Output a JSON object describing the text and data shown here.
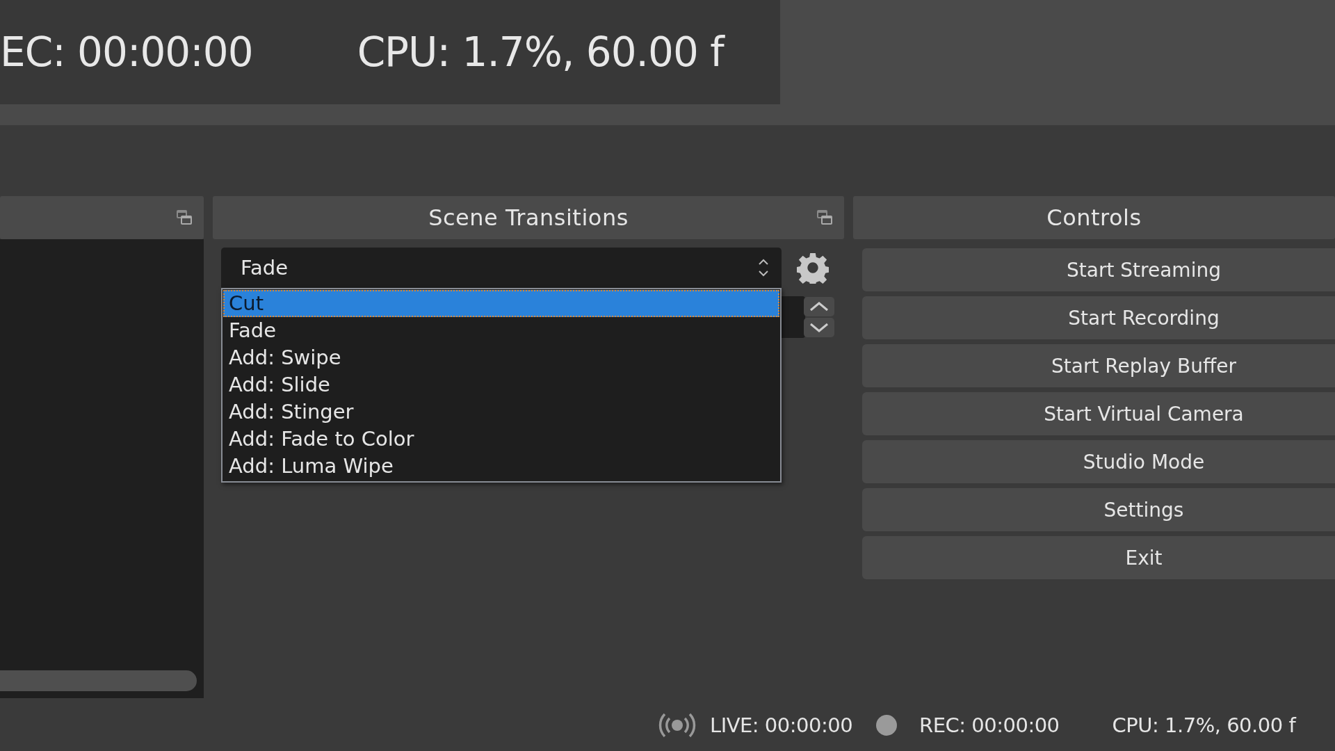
{
  "stats_overlay": {
    "recording_time": "EC: 00:00:00",
    "cpu": "CPU: 1.7%, 60.00 f"
  },
  "scene_transitions": {
    "title": "Scene Transitions",
    "transition": {
      "value": "Fade",
      "expanded": true,
      "options": [
        {
          "label": "Cut",
          "highlighted": true
        },
        {
          "label": "Fade",
          "highlighted": false
        },
        {
          "label": "Add: Swipe",
          "highlighted": false
        },
        {
          "label": "Add: Slide",
          "highlighted": false
        },
        {
          "label": "Add: Stinger",
          "highlighted": false
        },
        {
          "label": "Add: Fade to Color",
          "highlighted": false
        },
        {
          "label": "Add: Luma Wipe",
          "highlighted": false
        }
      ]
    }
  },
  "controls": {
    "title": "Controls",
    "buttons": [
      "Start Streaming",
      "Start Recording",
      "Start Replay Buffer",
      "Start Virtual Camera",
      "Studio Mode",
      "Settings",
      "Exit"
    ]
  },
  "status_bar": {
    "live": "LIVE: 00:00:00",
    "rec": "REC: 00:00:00",
    "cpu": "CPU: 1.7%, 60.00 f"
  }
}
